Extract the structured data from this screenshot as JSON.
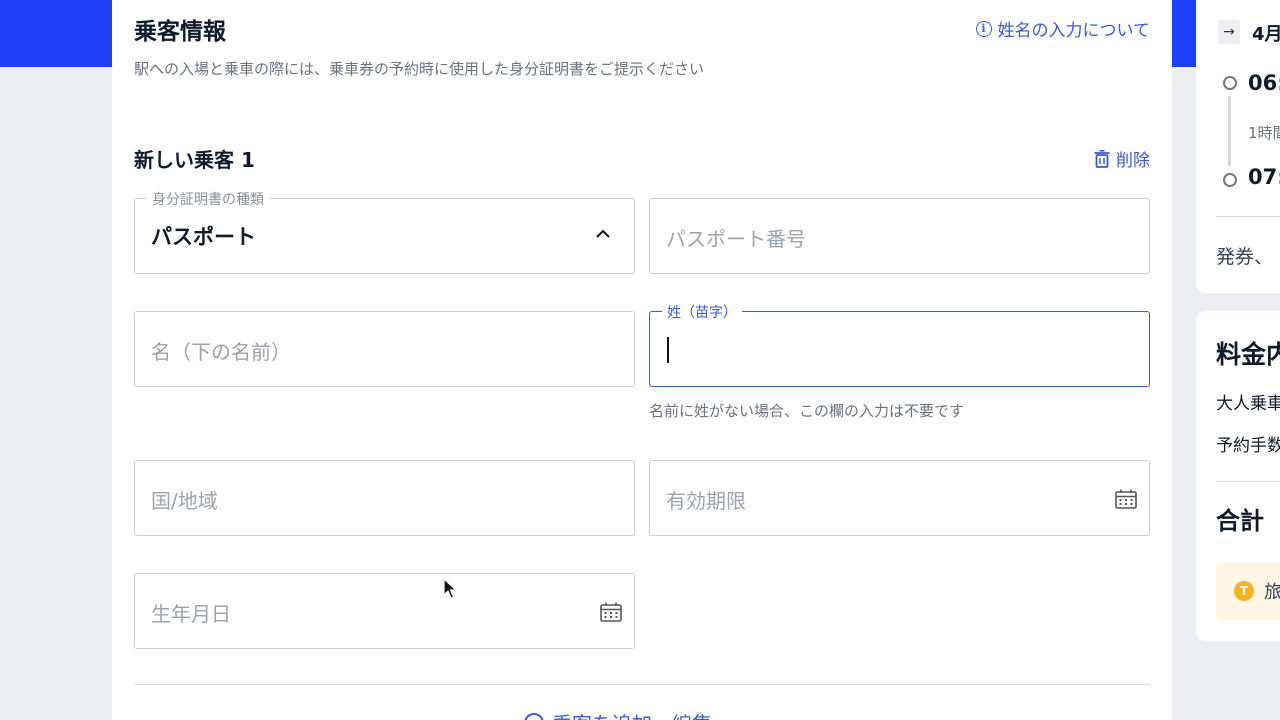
{
  "passenger_section": {
    "title": "乗客情報",
    "subtitle": "駅への入場と乗車の際には、乗車券の予約時に使用した身分証明書をご提示ください",
    "name_help_link": "姓名の入力について"
  },
  "passenger": {
    "title": "新しい乗客 1",
    "delete_label": "削除",
    "id_type": {
      "label": "身分証明書の種類",
      "value": "パスポート"
    },
    "passport_number": {
      "placeholder": "パスポート番号"
    },
    "first_name": {
      "placeholder": "名（下の名前）"
    },
    "last_name": {
      "label": "姓（苗字）",
      "help": "名前に姓がない場合、この欄の入力は不要です"
    },
    "country": {
      "placeholder": "国/地域"
    },
    "expiry": {
      "placeholder": "有効期限"
    },
    "birthdate": {
      "placeholder": "生年月日"
    }
  },
  "add_passenger_label": "乗客を追加・編集",
  "summary": {
    "date_label": "4月",
    "depart_time": "06:",
    "duration": "1時間",
    "arrive_time": "07:",
    "issue_text": "発券、"
  },
  "fare": {
    "title": "料金内",
    "adult_row": "大人乗車",
    "booking_fee_row": "予約手数",
    "total_label": "合計",
    "banner_coin": "T",
    "banner_text": "旅"
  },
  "colors": {
    "brand_blue": "#1f3ff5",
    "link_blue": "#3b5bdb"
  }
}
